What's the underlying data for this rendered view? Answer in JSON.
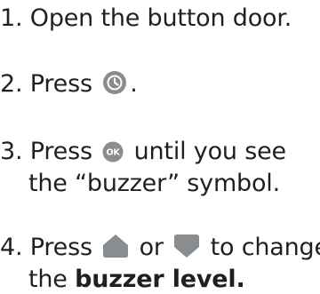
{
  "steps": {
    "s1": {
      "num": "1.",
      "text": "Open the button door."
    },
    "s2": {
      "num": "2.",
      "before": "Press",
      "after": ".",
      "icon": "clock-button-icon"
    },
    "s3": {
      "num": "3.",
      "before": "Press",
      "after": "until you see",
      "line2": "the “buzzer” symbol.",
      "icon": "ok-button-icon"
    },
    "s4": {
      "num": "4.",
      "before": "Press",
      "middle": "or",
      "after": "to change",
      "line2_plain": "the",
      "line2_bold": "buzzer level.",
      "icon_up": "up-button-icon",
      "icon_down": "down-button-icon"
    }
  },
  "colors": {
    "text": "#231f20",
    "button_fill": "#8a8d8f",
    "button_glyph": "#ffffff"
  }
}
